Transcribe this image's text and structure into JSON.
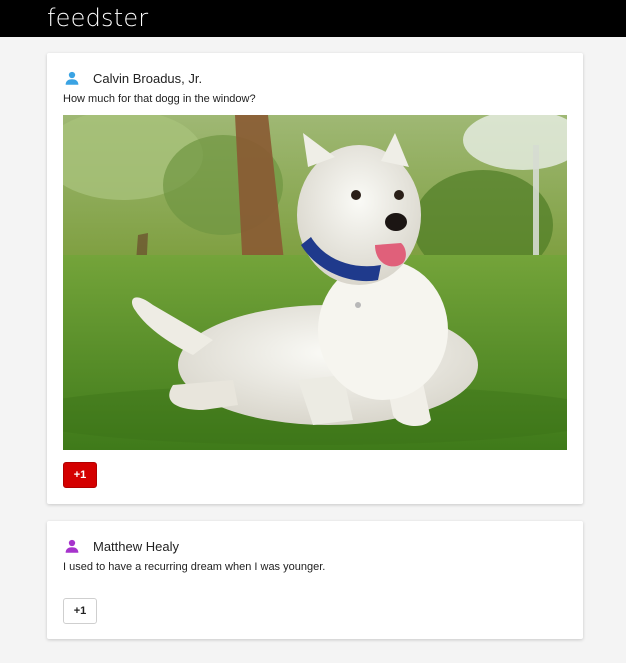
{
  "app": {
    "brand": "feedster"
  },
  "colors": {
    "topbar": "#000000",
    "accent_red": "#d40000",
    "user_blue": "#3aa3e3",
    "user_purple": "#a633cc"
  },
  "posts": [
    {
      "author": "Calvin Broadus, Jr.",
      "author_icon": "person-icon",
      "author_icon_color": "#3aa3e3",
      "text": "How much for that dogg in the window?",
      "image": "west-highland-terrier-on-grass",
      "plus_label": "+1",
      "plus_active": true
    },
    {
      "author": "Matthew Healy",
      "author_icon": "person-icon",
      "author_icon_color": "#a633cc",
      "text": "I used to have a recurring dream when I was younger.",
      "plus_label": "+1",
      "plus_active": false
    }
  ]
}
